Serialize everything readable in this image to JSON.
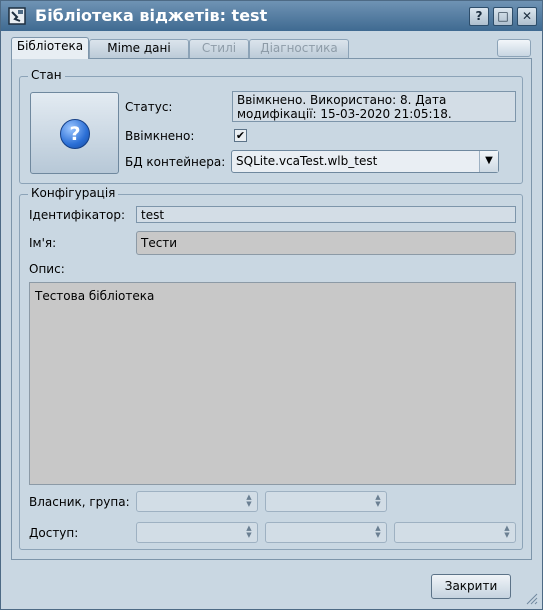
{
  "window": {
    "title": "Бібліотека віджетів: test",
    "help_button": "?",
    "maximize_button": "□",
    "close_button": "✕"
  },
  "tabs": [
    {
      "label": "Бібліотека",
      "active": true
    },
    {
      "label": "Mime дані",
      "active": false
    },
    {
      "label": "Стилі",
      "active": false,
      "disabled": true
    },
    {
      "label": "Діагностика",
      "active": false,
      "disabled": true
    }
  ],
  "state": {
    "group_title": "Стан",
    "status_label": "Статус:",
    "status_line1": "Ввімкнено. Використано: 8. Дата",
    "status_line2": "модифікації: 15-03-2020 21:05:18.",
    "enabled_label": "Ввімкнено:",
    "enabled_checked": true,
    "db_label": "БД контейнера:",
    "db_value": "SQLite.vcaTest.wlb_test"
  },
  "config": {
    "group_title": "Конфігурація",
    "id_label": "Ідентифікатор:",
    "id_value": "test",
    "name_label": "Ім'я:",
    "name_value": "Тести",
    "desc_label": "Опис:",
    "desc_value": "Тестова бібліотека",
    "owner_label": "Власник, група:",
    "access_label": "Доступ:"
  },
  "footer": {
    "close_label": "Закрити"
  }
}
